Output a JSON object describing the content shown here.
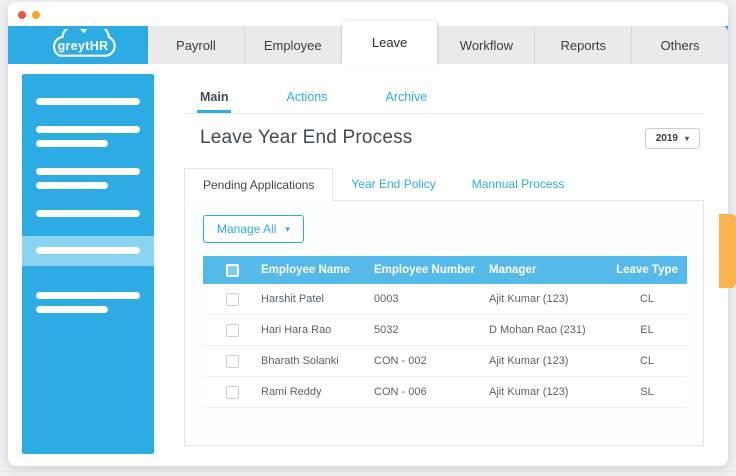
{
  "brand": {
    "name": "greytHR"
  },
  "nav": {
    "tabs": [
      {
        "label": "Payroll",
        "active": false
      },
      {
        "label": "Employee",
        "active": false
      },
      {
        "label": "Leave",
        "active": true
      },
      {
        "label": "Workflow",
        "active": false
      },
      {
        "label": "Reports",
        "active": false
      },
      {
        "label": "Others",
        "active": false
      }
    ]
  },
  "tabs": [
    {
      "label": "Main",
      "active": true
    },
    {
      "label": "Actions",
      "active": false
    },
    {
      "label": "Archive",
      "active": false
    }
  ],
  "page": {
    "title": "Leave Year End Process",
    "year": "2019"
  },
  "subtabs": [
    {
      "label": "Pending Applications",
      "active": true
    },
    {
      "label": "Year End Policy",
      "active": false
    },
    {
      "label": "Mannual Process",
      "active": false
    }
  ],
  "toolbar": {
    "manage_all": "Manage All"
  },
  "table": {
    "headers": [
      "Employee Name",
      "Employee Number",
      "Manager",
      "Leave Type"
    ],
    "rows": [
      {
        "name": "Harshit Patel",
        "number": "0003",
        "manager": "Ajit Kumar (123)",
        "leave_type": "CL"
      },
      {
        "name": "Hari Hara Rao",
        "number": "5032",
        "manager": "D Mohan Rao (231)",
        "leave_type": "EL"
      },
      {
        "name": "Bharath Solanki",
        "number": "CON - 002",
        "manager": "Ajit Kumar (123)",
        "leave_type": "CL"
      },
      {
        "name": "Rami Reddy",
        "number": "CON - 006",
        "manager": "Ajit Kumar (123)",
        "leave_type": "SL"
      }
    ]
  },
  "icons": {
    "caret_down": "▾"
  },
  "colors": {
    "accent": "#2CACE3",
    "table_header": "#55B9EA",
    "side_tab_orange": "#F9B44D"
  }
}
